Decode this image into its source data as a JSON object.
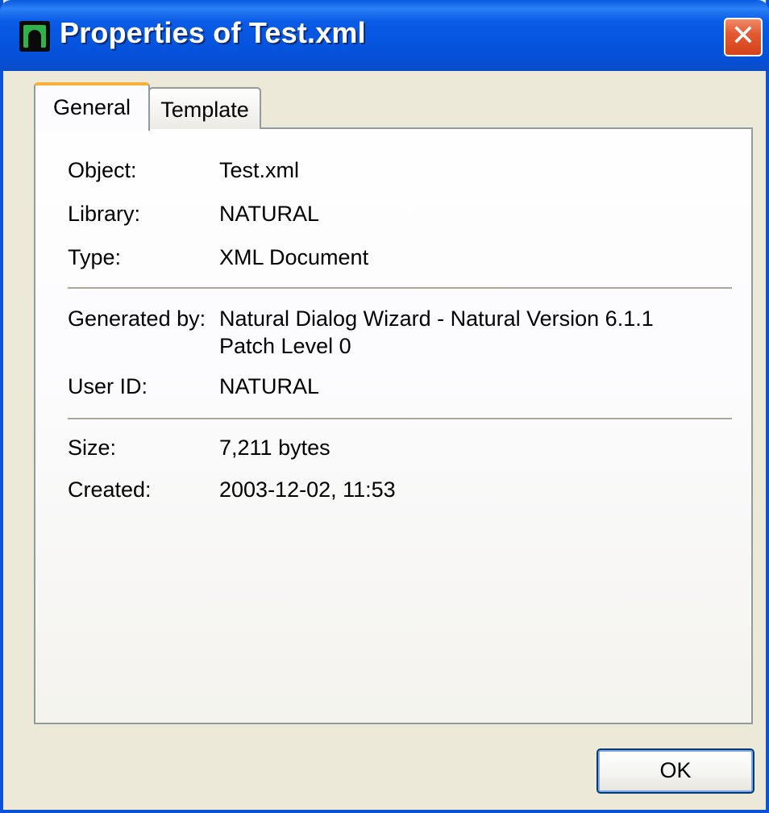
{
  "window": {
    "title": "Properties of Test.xml",
    "close_glyph": "✕",
    "app_icon": "natural-app-icon",
    "colors": {
      "titlebar": "#0a5be6",
      "frame": "#ece9d8",
      "close_button": "#e25a33",
      "active_tab_accent": "#f9b13a"
    }
  },
  "tabs": [
    {
      "label": "General",
      "active": true
    },
    {
      "label": "Template",
      "active": false
    }
  ],
  "general": {
    "object": {
      "label": "Object:",
      "value": "Test.xml"
    },
    "library": {
      "label": "Library:",
      "value": "NATURAL"
    },
    "type": {
      "label": "Type:",
      "value": "XML Document"
    },
    "generated_by": {
      "label": "Generated by:",
      "value_line1": "Natural Dialog Wizard - Natural Version 6.1.1",
      "value_line2": "Patch Level 0"
    },
    "user_id": {
      "label": "User ID:",
      "value": "NATURAL"
    },
    "size": {
      "label": "Size:",
      "value": "7,211 bytes"
    },
    "created": {
      "label": "Created:",
      "value": "2003-12-02, 11:53"
    }
  },
  "buttons": {
    "ok_label": "OK"
  }
}
